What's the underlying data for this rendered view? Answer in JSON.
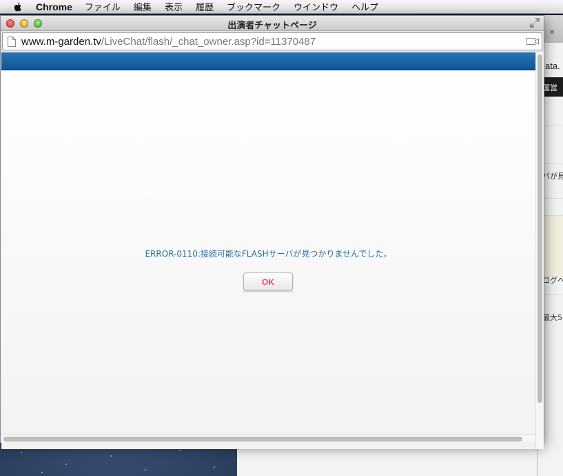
{
  "menubar": {
    "app_name": "Chrome",
    "items": [
      "ファイル",
      "編集",
      "表示",
      "履歴",
      "ブックマーク",
      "ウインドウ",
      "ヘルプ"
    ]
  },
  "popup": {
    "title": "出演者チャットページ",
    "url_host": "www.m-garden.tv",
    "url_path": "/LiveChat/flash/_chat_owner.asp?id=11370487",
    "error_message": "ERROR-0110:接続可能なFLASHサーバが見つかりませんでした。",
    "ok_label": "OK"
  },
  "background_window": {
    "url_fragment": "ata.",
    "header_fragment": "運営",
    "text_fragments": [
      "バが見",
      "ログへ",
      "最大5"
    ]
  },
  "colors": {
    "header_blue": "#1b67a8",
    "error_text": "#2b6f9b",
    "ok_text": "#e0447f"
  }
}
